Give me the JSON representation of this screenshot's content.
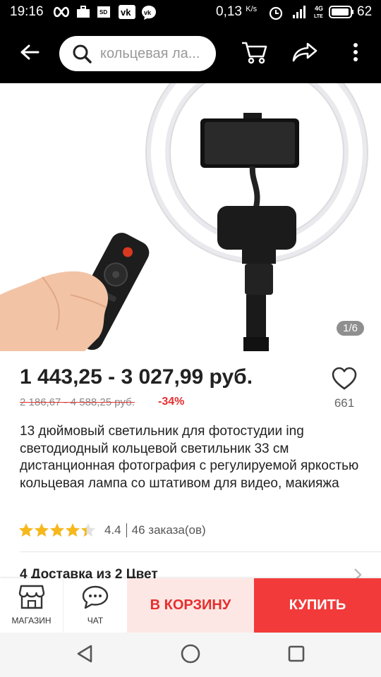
{
  "status_bar": {
    "time": "19:16",
    "speed": "0,13",
    "speed_unit": "K/s",
    "network": "4G LTE",
    "battery": "62",
    "icons": [
      "infinity-icon",
      "briefcase-icon",
      "sd-card-icon",
      "vk-icon",
      "vk-messenger-icon",
      "alarm-icon",
      "signal-icon",
      "battery-icon"
    ]
  },
  "toolbar": {
    "search_placeholder": "кольцевая ла...",
    "icons": [
      "back-arrow-icon",
      "search-icon",
      "cart-icon",
      "share-icon",
      "more-vertical-icon"
    ]
  },
  "gallery": {
    "pager": "1/6",
    "image_description_icon": "ring-light-product-image"
  },
  "product": {
    "price": "1 443,25 - 3 027,99 руб.",
    "old_price": "2 186,67 - 4 588,25 руб.",
    "discount": "-34%",
    "wish_count": "661",
    "title": "13 дюймовый светильник для фотостудии ing светодиодный кольцевой светильник 33 см дистанционная фотография с регулируемой яркостью кольцевая лампа со штативом для видео, макияжа",
    "rating_value": "4.4",
    "rating_fraction": 0.88,
    "orders": "46 заказа(ов)"
  },
  "options": {
    "summary": "4 Доставка из  2 Цвет"
  },
  "actions": {
    "shop_label": "МАГАЗИН",
    "chat_label": "ЧАТ",
    "cart_label": "В КОРЗИНУ",
    "buy_label": "КУПИТЬ"
  },
  "colors": {
    "accent": "#f23a3a",
    "accent_light": "#fde7e4",
    "star": "#f7b81b"
  }
}
